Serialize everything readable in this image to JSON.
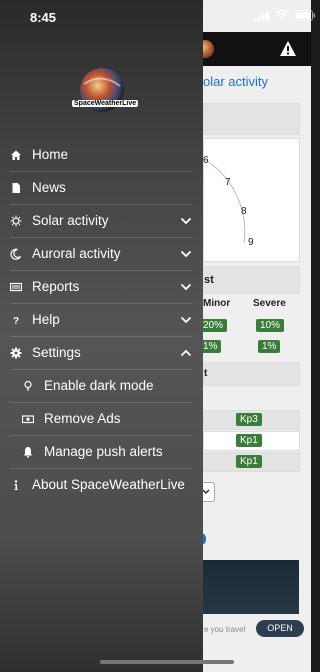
{
  "status": {
    "time": "8:45"
  },
  "logo": {
    "text": "SpaceWeatherLive"
  },
  "menu": [
    {
      "label": "Home",
      "icon": "home-icon",
      "chevron": ""
    },
    {
      "label": "News",
      "icon": "document-icon",
      "chevron": ""
    },
    {
      "label": "Solar activity",
      "icon": "sun-icon",
      "chevron": "down"
    },
    {
      "label": "Auroral activity",
      "icon": "moon-icon",
      "chevron": "down"
    },
    {
      "label": "Reports",
      "icon": "reports-icon",
      "chevron": "down"
    },
    {
      "label": "Help",
      "icon": "question-icon",
      "chevron": "down"
    },
    {
      "label": "Settings",
      "icon": "gear-icon",
      "chevron": "up"
    }
  ],
  "submenu": [
    {
      "label": "Enable dark mode",
      "icon": "lightbulb-icon"
    },
    {
      "label": "Remove Ads",
      "icon": "money-icon"
    },
    {
      "label": "Manage push alerts",
      "icon": "bell-icon"
    }
  ],
  "about": {
    "label": "About SpaceWeatherLive",
    "icon": "info-icon"
  },
  "background": {
    "title": "olar activity",
    "gauge_ticks": [
      "7",
      "8",
      "9"
    ],
    "gauge_tick_partial": "6",
    "forecast_title": "st",
    "col_minor": "Minor",
    "col_severe": "Severe",
    "row1": [
      "20%",
      "10%"
    ],
    "row2": [
      "1%",
      "1%"
    ],
    "kp_section_letter": "t",
    "kp_values": [
      "Kp3",
      "Kp1",
      "Kp1"
    ],
    "ad_text": "e you travel",
    "ad_button": "OPEN"
  }
}
